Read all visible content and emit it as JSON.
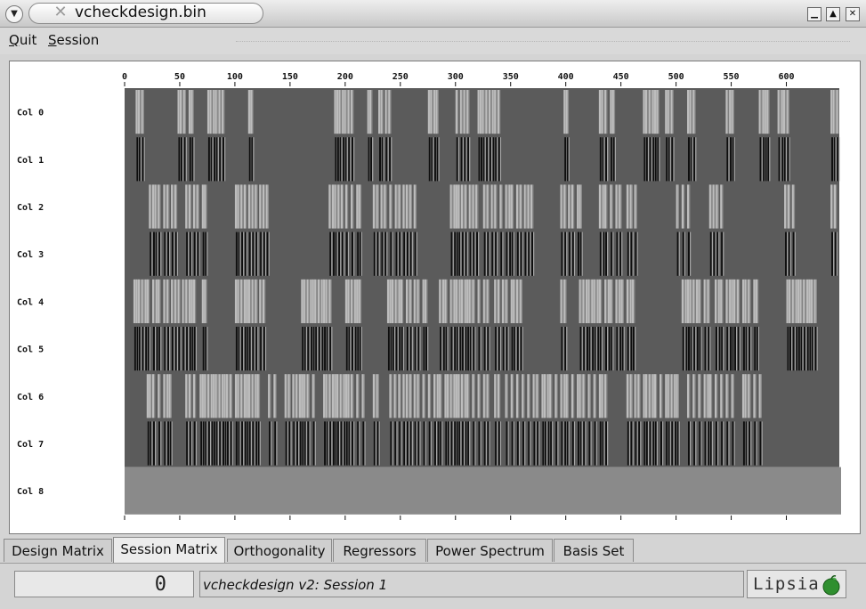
{
  "window": {
    "title": "vcheckdesign.bin"
  },
  "menu": {
    "quit": "Quit",
    "quit_accel": "Q",
    "quit_rest": "uit",
    "session": "Session",
    "session_accel": "S",
    "session_rest": "ession"
  },
  "colors": {
    "panel": "#ffffff",
    "matrix_background": "#5b5b5b",
    "row8": "#8a8a8a",
    "stripe_light": "#bdbdbd",
    "stripe_dark": "#0e0e0e"
  },
  "matrix": {
    "x_ticks": [
      "0",
      "50",
      "100",
      "150",
      "200",
      "250",
      "300",
      "350",
      "400",
      "450",
      "500",
      "550",
      "600"
    ],
    "x_max": 648,
    "row_labels": [
      "Col 0",
      "Col 1",
      "Col 2",
      "Col 3",
      "Col 4",
      "Col 5",
      "Col 6",
      "Col 7",
      "Col 8"
    ],
    "paired_rows": [
      [
        10,
        12,
        15,
        48,
        50,
        53,
        58,
        60,
        75,
        77,
        80,
        82,
        85,
        88,
        112,
        114,
        190,
        192,
        194,
        197,
        199,
        202,
        205,
        220,
        222,
        230,
        232,
        236,
        239,
        275,
        277,
        280,
        282,
        300,
        304,
        307,
        310,
        320,
        322,
        324,
        327,
        330,
        333,
        335,
        338,
        398,
        400,
        430,
        432,
        435,
        440,
        442,
        470,
        472,
        475,
        478,
        480,
        482,
        490,
        492,
        495,
        510,
        512,
        515,
        545,
        548,
        550,
        575,
        578,
        580,
        582,
        592,
        595,
        597,
        600,
        640,
        642,
        645
      ],
      [
        22,
        25,
        27,
        30,
        35,
        38,
        42,
        45,
        55,
        58,
        62,
        65,
        70,
        72,
        100,
        102,
        105,
        108,
        112,
        115,
        118,
        122,
        125,
        128,
        185,
        188,
        190,
        193,
        196,
        200,
        205,
        210,
        212,
        225,
        228,
        232,
        235,
        240,
        245,
        248,
        252,
        255,
        258,
        262,
        295,
        298,
        300,
        302,
        305,
        308,
        312,
        315,
        318,
        325,
        328,
        332,
        335,
        340,
        345,
        348,
        350,
        355,
        358,
        362,
        365,
        368,
        395,
        398,
        402,
        405,
        410,
        412,
        430,
        433,
        435,
        440,
        445,
        448,
        455,
        458,
        462,
        500,
        505,
        510,
        530,
        533,
        536,
        540,
        598,
        601,
        605,
        640,
        643
      ],
      [
        8,
        10,
        12,
        15,
        18,
        20,
        25,
        28,
        30,
        35,
        38,
        42,
        45,
        48,
        52,
        55,
        58,
        60,
        62,
        70,
        72,
        100,
        102,
        105,
        108,
        110,
        112,
        115,
        118,
        122,
        125,
        160,
        162,
        165,
        168,
        170,
        172,
        175,
        178,
        180,
        182,
        185,
        200,
        202,
        205,
        208,
        210,
        212,
        238,
        240,
        242,
        245,
        248,
        250,
        255,
        258,
        262,
        265,
        270,
        272,
        285,
        288,
        290,
        295,
        298,
        300,
        303,
        305,
        308,
        310,
        312,
        315,
        320,
        325,
        328,
        335,
        338,
        342,
        345,
        350,
        352,
        355,
        358,
        395,
        398,
        412,
        415,
        418,
        420,
        423,
        425,
        428,
        430,
        435,
        438,
        440,
        445,
        448,
        450,
        455,
        458,
        460,
        505,
        508,
        510,
        512,
        515,
        518,
        520,
        525,
        528,
        535,
        538,
        540,
        545,
        548,
        550,
        552,
        555,
        560,
        562,
        565,
        570,
        572,
        600,
        602,
        605,
        608,
        610,
        612,
        615,
        618,
        620,
        622,
        625
      ],
      [
        20,
        22,
        25,
        30,
        35,
        38,
        40,
        55,
        58,
        62,
        68,
        70,
        72,
        75,
        78,
        80,
        82,
        85,
        88,
        90,
        92,
        95,
        100,
        102,
        105,
        108,
        110,
        112,
        115,
        118,
        120,
        130,
        135,
        145,
        148,
        152,
        155,
        158,
        160,
        162,
        165,
        170,
        180,
        182,
        185,
        188,
        190,
        192,
        195,
        198,
        200,
        202,
        205,
        210,
        215,
        225,
        228,
        240,
        244,
        248,
        252,
        255,
        258,
        262,
        265,
        270,
        275,
        280,
        283,
        285,
        290,
        292,
        295,
        298,
        300,
        302,
        305,
        308,
        310,
        315,
        320,
        325,
        328,
        335,
        338,
        345,
        350,
        355,
        360,
        365,
        370,
        373,
        378,
        380,
        383,
        385,
        390,
        395,
        398,
        400,
        405,
        410,
        412,
        415,
        420,
        425,
        430,
        432,
        435,
        455,
        458,
        462,
        465,
        470,
        472,
        475,
        478,
        480,
        485,
        490,
        492,
        495,
        498,
        500,
        510,
        515,
        520,
        525,
        528,
        530,
        535,
        540,
        545,
        550,
        560,
        562,
        565,
        570,
        575
      ]
    ]
  },
  "tabs": [
    "Design Matrix",
    "Session Matrix",
    "Orthogonality",
    "Regressors",
    "Power Spectrum",
    "Basis Set"
  ],
  "active_tab": 1,
  "status": {
    "counter": "0",
    "message": "vcheckdesign v2: Session 1",
    "logo_text": "Lipsia"
  }
}
